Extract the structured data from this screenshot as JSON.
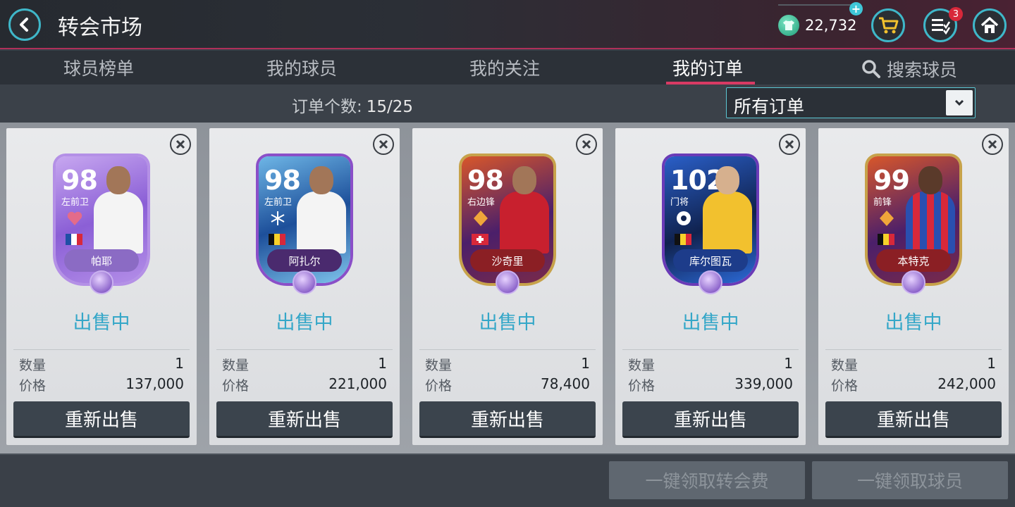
{
  "header": {
    "title": "转会市场",
    "coins": "22,732",
    "notification_count": "3",
    "icons": [
      "back-arrow-icon",
      "coin-jersey-icon",
      "plus-icon",
      "cart-icon",
      "task-list-icon",
      "home-icon"
    ]
  },
  "tabs": [
    {
      "label": "球员榜单",
      "active": false
    },
    {
      "label": "我的球员",
      "active": false
    },
    {
      "label": "我的关注",
      "active": false
    },
    {
      "label": "我的订单",
      "active": true
    },
    {
      "label": "搜索球员",
      "active": false
    }
  ],
  "filter": {
    "count_label": "订单个数:",
    "count_value": "15/25",
    "dropdown_value": "所有订单"
  },
  "cards": [
    {
      "rating": "98",
      "position": "左前卫",
      "name": "帕耶",
      "status": "出售中",
      "quantity_label": "数量",
      "quantity": "1",
      "price_label": "价格",
      "price": "137,000",
      "button": "重新出售"
    },
    {
      "rating": "98",
      "position": "左前卫",
      "name": "阿扎尔",
      "status": "出售中",
      "quantity_label": "数量",
      "quantity": "1",
      "price_label": "价格",
      "price": "221,000",
      "button": "重新出售"
    },
    {
      "rating": "98",
      "position": "右边锋",
      "name": "沙奇里",
      "status": "出售中",
      "quantity_label": "数量",
      "quantity": "1",
      "price_label": "价格",
      "price": "78,400",
      "button": "重新出售"
    },
    {
      "rating": "102",
      "position": "门将",
      "name": "库尔图瓦",
      "status": "出售中",
      "quantity_label": "数量",
      "quantity": "1",
      "price_label": "价格",
      "price": "339,000",
      "button": "重新出售"
    },
    {
      "rating": "99",
      "position": "前锋",
      "name": "本特克",
      "status": "出售中",
      "quantity_label": "数量",
      "quantity": "1",
      "price_label": "价格",
      "price": "242,000",
      "button": "重新出售"
    }
  ],
  "footer": {
    "claim_fee_button": "一键领取转会费",
    "claim_players_button": "一键领取球员"
  },
  "colors": {
    "accent_cyan": "#3fb7c9",
    "tab_underline": "#d83a64",
    "status_text": "#35a7c8",
    "notification_badge": "#d8283a"
  }
}
